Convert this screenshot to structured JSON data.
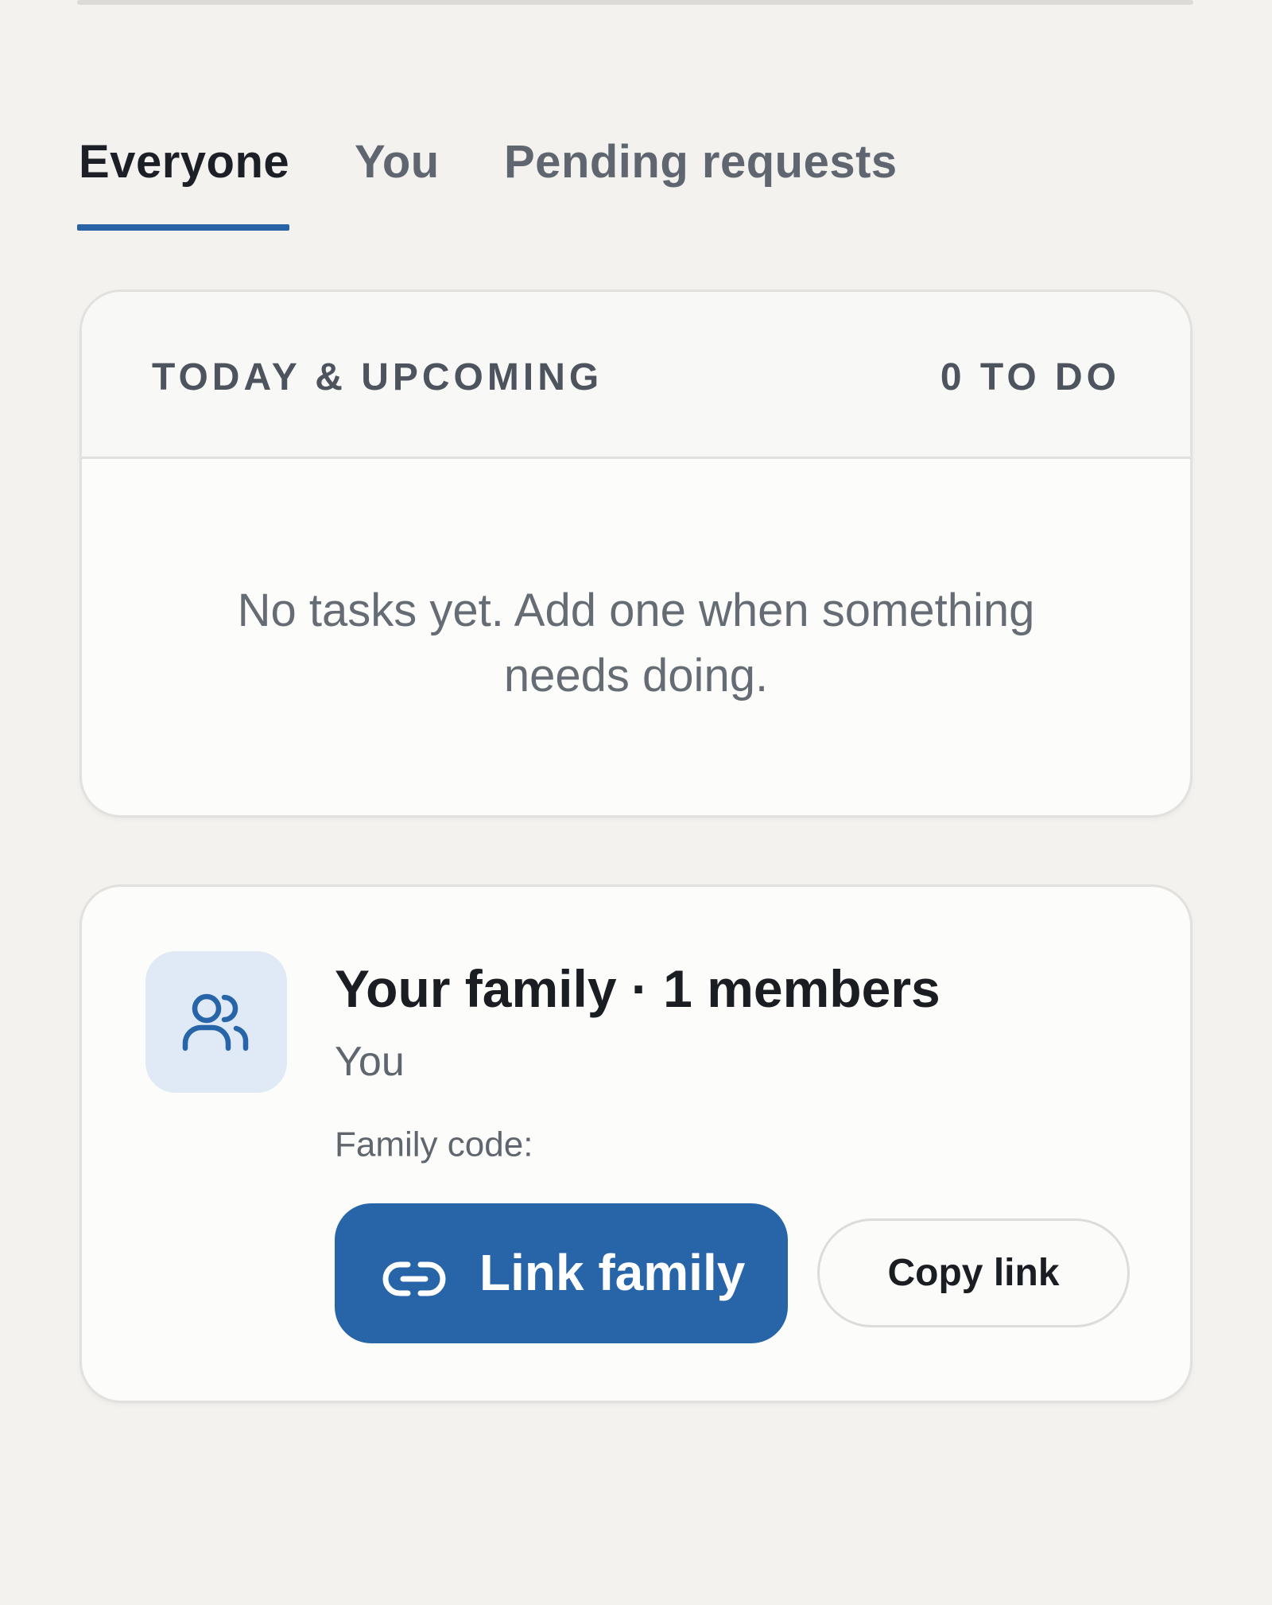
{
  "tabs": [
    {
      "label": "Everyone",
      "active": true
    },
    {
      "label": "You",
      "active": false
    },
    {
      "label": "Pending requests",
      "active": false
    }
  ],
  "tasks_card": {
    "title": "TODAY & UPCOMING",
    "count": "0 TO DO",
    "empty_message": "No tasks yet. Add one when something needs doing."
  },
  "family_card": {
    "icon": "users-icon",
    "title": "Your family · 1 members",
    "members": "You",
    "code_label": "Family code:",
    "link_button_icon": "link-icon",
    "link_button_label": "Link family",
    "copy_button_label": "Copy link"
  },
  "colors": {
    "accent": "#2765a8",
    "background": "#f3f2ef",
    "card": "#fcfcfa",
    "icon_tile": "#dfeaf6"
  }
}
